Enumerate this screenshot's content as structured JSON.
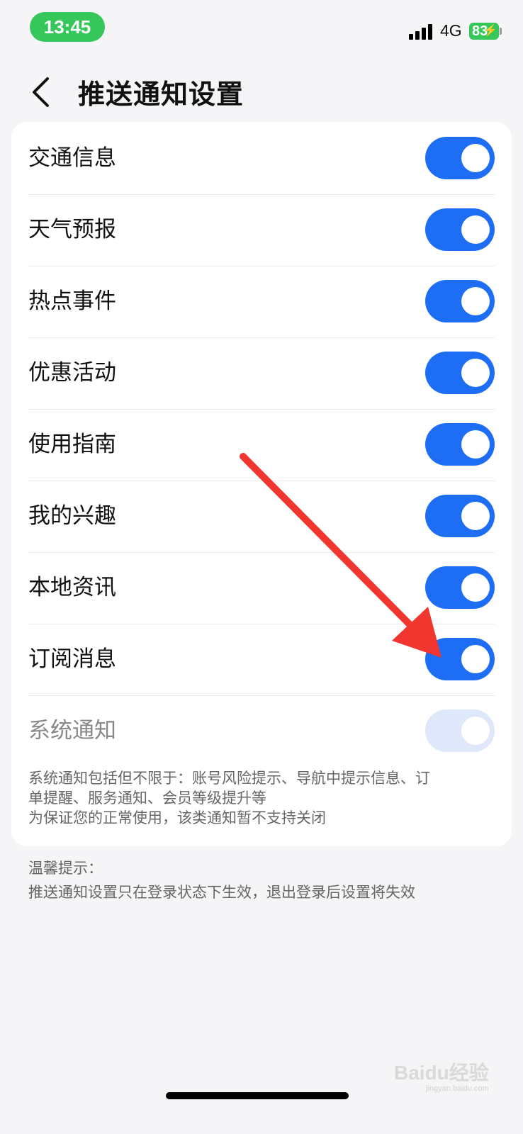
{
  "status_bar": {
    "time": "13:45",
    "network": "4G",
    "battery": "83",
    "accent_color": "#35c759"
  },
  "header": {
    "back_icon": "chevron-left-icon",
    "title": "推送通知设置"
  },
  "settings": {
    "toggle_on_color": "#1e6ef5",
    "items": [
      {
        "label": "交通信息",
        "enabled": true
      },
      {
        "label": "天气预报",
        "enabled": true
      },
      {
        "label": "热点事件",
        "enabled": true
      },
      {
        "label": "优惠活动",
        "enabled": true
      },
      {
        "label": "使用指南",
        "enabled": true
      },
      {
        "label": "我的兴趣",
        "enabled": true
      },
      {
        "label": "本地资讯",
        "enabled": true
      },
      {
        "label": "订阅消息",
        "enabled": true
      },
      {
        "label": "系统通知",
        "enabled": true,
        "disabled": true
      }
    ],
    "system_note": [
      "系统通知包括但不限于：账号风险提示、导航中提示信息、订",
      "单提醒、服务通知、会员等级提升等",
      "为保证您的正常使用，该类通知暂不支持关闭"
    ]
  },
  "tips": {
    "heading": "温馨提示：",
    "text": "推送通知设置只在登录状态下生效，退出登录后设置将失效"
  },
  "annotation": {
    "icon": "red-arrow-icon",
    "color": "#f0362e"
  },
  "watermark": {
    "text": "Baidu经验",
    "sub": "jingyan.baidu.com"
  }
}
